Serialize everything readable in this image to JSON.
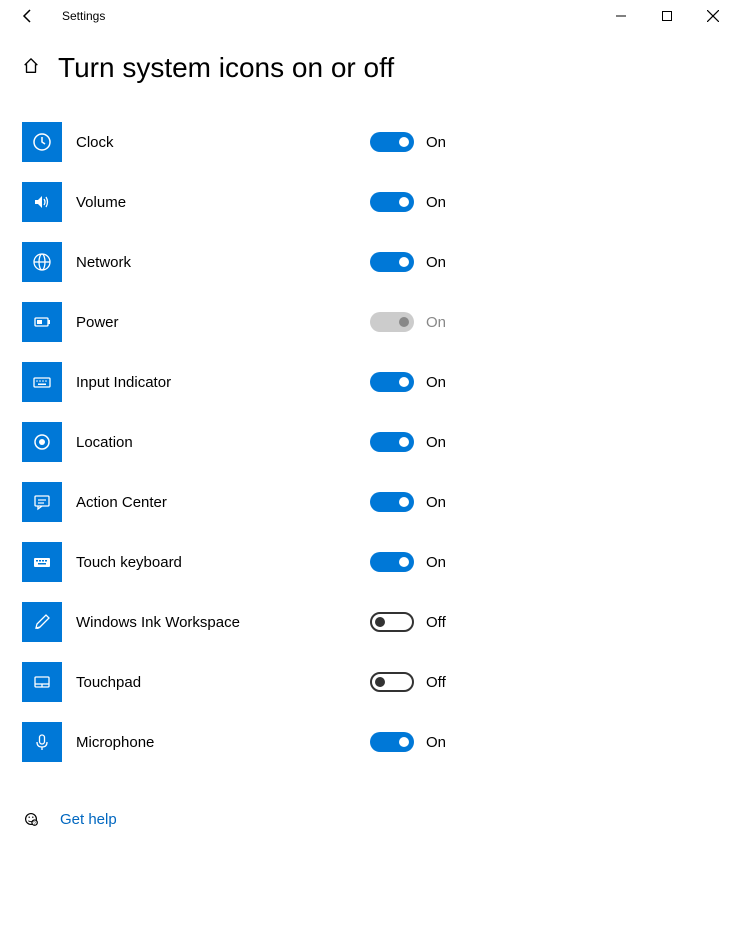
{
  "window": {
    "app_name": "Settings",
    "title": "Turn system icons on or off"
  },
  "items": [
    {
      "icon": "clock-icon",
      "label": "Clock",
      "state": "on",
      "state_text": "On"
    },
    {
      "icon": "volume-icon",
      "label": "Volume",
      "state": "on",
      "state_text": "On"
    },
    {
      "icon": "network-icon",
      "label": "Network",
      "state": "on",
      "state_text": "On"
    },
    {
      "icon": "power-icon",
      "label": "Power",
      "state": "disabled",
      "state_text": "On"
    },
    {
      "icon": "keyboard-icon",
      "label": "Input Indicator",
      "state": "on",
      "state_text": "On"
    },
    {
      "icon": "location-icon",
      "label": "Location",
      "state": "on",
      "state_text": "On"
    },
    {
      "icon": "message-icon",
      "label": "Action Center",
      "state": "on",
      "state_text": "On"
    },
    {
      "icon": "touchkbd-icon",
      "label": "Touch keyboard",
      "state": "on",
      "state_text": "On"
    },
    {
      "icon": "pen-icon",
      "label": "Windows Ink Workspace",
      "state": "off",
      "state_text": "Off"
    },
    {
      "icon": "touchpad-icon",
      "label": "Touchpad",
      "state": "off",
      "state_text": "Off"
    },
    {
      "icon": "mic-icon",
      "label": "Microphone",
      "state": "on",
      "state_text": "On"
    }
  ],
  "help": {
    "label": "Get help"
  }
}
